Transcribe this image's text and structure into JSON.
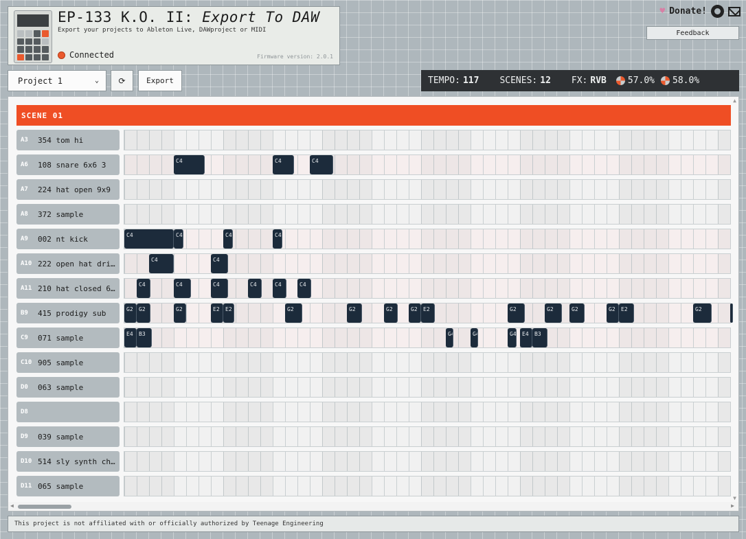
{
  "header": {
    "title_main": "EP-133 K.O. II: ",
    "title_italic": "Export To DAW",
    "subtitle": "Export your projects to Ableton Live, DAWproject or MIDI",
    "status": "Connected",
    "firmware": "Firmware version: 2.0.1"
  },
  "top_right": {
    "donate": "Donate!",
    "feedback": "Feedback"
  },
  "toolbar": {
    "project": "Project 1",
    "refresh": "⟳",
    "export": "Export"
  },
  "info": {
    "tempo_label": "TEMPO:",
    "tempo_value": "117",
    "scenes_label": "SCENES:",
    "scenes_value": "12",
    "fx_label": "FX:",
    "fx_value": "RVB",
    "knob1": "57.0%",
    "knob2": "58.0%"
  },
  "scene": {
    "title": "SCENE 01"
  },
  "tracks": [
    {
      "pad": "A3",
      "name": "354 tom hi",
      "tint": false,
      "notes": []
    },
    {
      "pad": "A6",
      "name": "108 snare 6x6 3",
      "tint": true,
      "notes": [
        {
          "label": "C4",
          "step": 4,
          "len": 2.5
        },
        {
          "label": "C4",
          "step": 12,
          "len": 1.7
        },
        {
          "label": "C4",
          "step": 15,
          "len": 1.9
        }
      ]
    },
    {
      "pad": "A7",
      "name": "224 hat open 9x9",
      "tint": false,
      "notes": []
    },
    {
      "pad": "A8",
      "name": "372 sample",
      "tint": false,
      "notes": []
    },
    {
      "pad": "A9",
      "name": "002 nt kick",
      "tint": true,
      "notes": [
        {
          "label": "C4",
          "step": 0,
          "len": 4.0
        },
        {
          "label": "C4",
          "step": 4,
          "len": 0.8
        },
        {
          "label": "C4",
          "step": 8,
          "len": 0.8
        },
        {
          "label": "C4",
          "step": 12,
          "len": 0.8
        }
      ]
    },
    {
      "pad": "A10",
      "name": "222 open hat dri…",
      "tint": true,
      "notes": [
        {
          "label": "C4",
          "step": 2,
          "len": 2.0
        },
        {
          "label": "C4",
          "step": 7,
          "len": 1.4
        }
      ]
    },
    {
      "pad": "A11",
      "name": "210 hat closed 6…",
      "tint": true,
      "notes": [
        {
          "label": "C4",
          "step": 1,
          "len": 1.1
        },
        {
          "label": "C4",
          "step": 4,
          "len": 1.4
        },
        {
          "label": "C4",
          "step": 7,
          "len": 1.4
        },
        {
          "label": "C4",
          "step": 10,
          "len": 1.1
        },
        {
          "label": "C4",
          "step": 12,
          "len": 1.1
        },
        {
          "label": "C4",
          "step": 14,
          "len": 1.1
        }
      ]
    },
    {
      "pad": "B9",
      "name": "415 prodigy sub",
      "tint": true,
      "notes": [
        {
          "label": "G2",
          "step": 0,
          "len": 1.0
        },
        {
          "label": "G2",
          "step": 1,
          "len": 1.1
        },
        {
          "label": "G2",
          "step": 4,
          "len": 1.0
        },
        {
          "label": "E2",
          "step": 7,
          "len": 1.0
        },
        {
          "label": "E2",
          "step": 8,
          "len": 0.9
        },
        {
          "label": "G2",
          "step": 13,
          "len": 1.4
        },
        {
          "label": "G2",
          "step": 18,
          "len": 1.2
        },
        {
          "label": "G2",
          "step": 21,
          "len": 1.1
        },
        {
          "label": "G2",
          "step": 23,
          "len": 1.0
        },
        {
          "label": "E2",
          "step": 24,
          "len": 1.1
        },
        {
          "label": "G2",
          "step": 31,
          "len": 1.4
        },
        {
          "label": "G2",
          "step": 34,
          "len": 1.4
        },
        {
          "label": "G2",
          "step": 36,
          "len": 1.2
        },
        {
          "label": "G2",
          "step": 39,
          "len": 1.0
        },
        {
          "label": "E2",
          "step": 40,
          "len": 1.2
        },
        {
          "label": "G2",
          "step": 46,
          "len": 1.5
        },
        {
          "label": "",
          "step": 49,
          "len": 0.15
        }
      ]
    },
    {
      "pad": "C9",
      "name": "071 sample",
      "tint": true,
      "notes": [
        {
          "label": "E4",
          "step": 0,
          "len": 1.0
        },
        {
          "label": "B3",
          "step": 1,
          "len": 1.2
        },
        {
          "label": "G4",
          "step": 26,
          "len": 0.6
        },
        {
          "label": "G4",
          "step": 28,
          "len": 0.6
        },
        {
          "label": "G4",
          "step": 31,
          "len": 0.7
        },
        {
          "label": "E4",
          "step": 32,
          "len": 1.0
        },
        {
          "label": "B3",
          "step": 33,
          "len": 1.2
        }
      ]
    },
    {
      "pad": "C10",
      "name": "905 sample",
      "tint": false,
      "notes": []
    },
    {
      "pad": "D0",
      "name": "063 sample",
      "tint": false,
      "notes": []
    },
    {
      "pad": "D8",
      "name": "",
      "tint": false,
      "notes": []
    },
    {
      "pad": "D9",
      "name": "039 sample",
      "tint": false,
      "notes": []
    },
    {
      "pad": "D10",
      "name": "514 sly synth ch…",
      "tint": false,
      "notes": []
    },
    {
      "pad": "D11",
      "name": "065 sample",
      "tint": false,
      "notes": []
    }
  ],
  "footer": {
    "disclaimer": "This project is not affiliated with or officially authorized by Teenage Engineering"
  },
  "colors": {
    "accent": "#ef4e24",
    "note": "#1c2b3b",
    "status": "#ea5a2e"
  },
  "icons": [
    "heart-icon",
    "github-icon",
    "mail-icon",
    "chevron-down-icon",
    "refresh-icon"
  ]
}
